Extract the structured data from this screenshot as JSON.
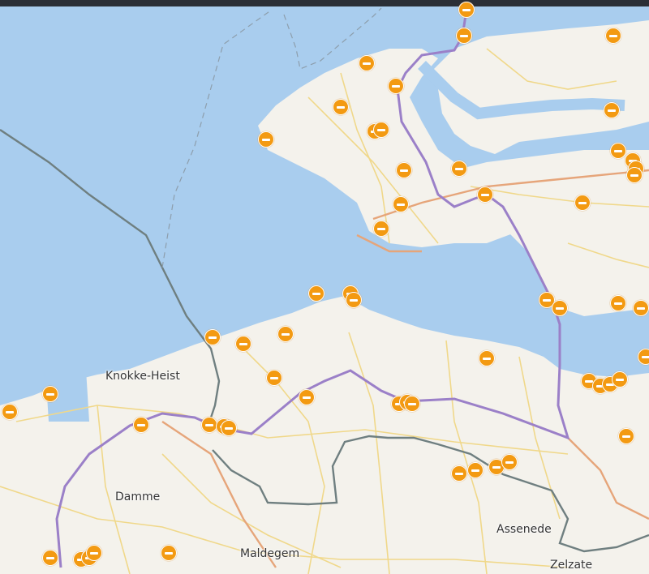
{
  "map": {
    "colors": {
      "water": "#a9cdee",
      "land": "#f4f2ec",
      "road_minor": "#f0d88a",
      "road_major": "#e6a57a",
      "route": "#9b80c8",
      "border": "#6f7f80",
      "marker": "#f39a12"
    },
    "labels": {
      "knokke_heist": "Knokke-Heist",
      "damme": "Damme",
      "maldegem": "Maldegem",
      "assenede": "Assenede",
      "zelzate": "Zelzate"
    },
    "marker_icon": "road-closure-icon",
    "marker_count": 57
  }
}
